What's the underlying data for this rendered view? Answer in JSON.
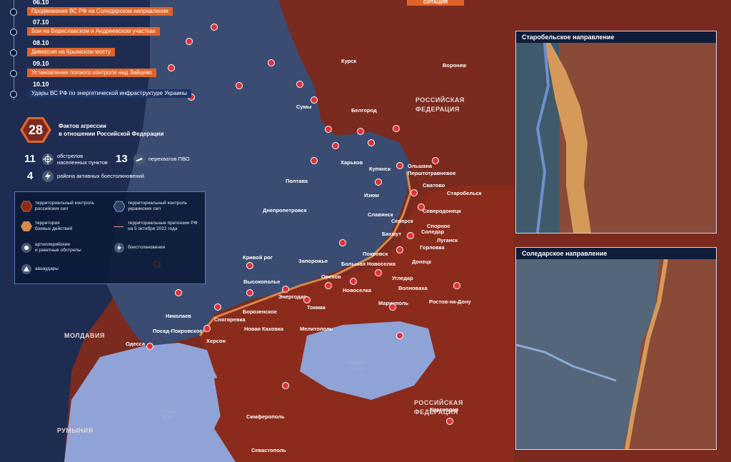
{
  "timeline": [
    {
      "date": "06.10",
      "text": "Продвижение ВС РФ на Соледарском направлении"
    },
    {
      "date": "07.10",
      "text": "Бои на Бериславском и Андреевском участках"
    },
    {
      "date": "08.10",
      "text": "Диверсия на Крымском мосту"
    },
    {
      "date": "09.10",
      "text": "Установление полного контроля над Зайцево"
    },
    {
      "date": "10.10",
      "text": "Удары ВС РФ по энергетической инфраструктуре Украины"
    }
  ],
  "stats": {
    "main_number": "28",
    "main_label_1": "Фактов агрессии",
    "main_label_2": "в отношении Российской Федерации",
    "shelling_number": "11",
    "shelling_label_1": "обстрелов",
    "shelling_label_2": "населенных пунктов",
    "intercept_number": "13",
    "intercept_label": "перехватов ПВО",
    "areas_number": "4",
    "areas_label": "района активных боестолкновений"
  },
  "legend": {
    "russian_control": "территориальный контроль российских сил",
    "ukrainian_control": "территориальный контроль украинских сил",
    "combat_zone_1": "территория",
    "combat_zone_2": "боевых действий",
    "claims_1": "территориальные претензии РФ",
    "claims_2": "на 5 октября 2022 года",
    "artillery_1": "артиллерийские",
    "artillery_2": "и ракетные обстрелы",
    "clashes": "боестолкновения",
    "airstrikes": "авиаудары"
  },
  "colors": {
    "russian_control": "#8b2b1c",
    "ukrainian_control": "#2c3f63",
    "combat_zone": "#d58a4a",
    "accent": "#e0642a",
    "sea": "#8fa3d6",
    "panel": "#0a1937"
  },
  "map": {
    "countries": [
      {
        "id": "russia",
        "label_1": "РОССИЙСКАЯ",
        "label_2": "ФЕДЕРАЦИЯ"
      },
      {
        "id": "russia-south",
        "label_1": "РОССИЙСКАЯ",
        "label_2": "ФЕДЕРАЦИЯ"
      },
      {
        "id": "moldova",
        "label_1": "МОЛДАВИЯ"
      },
      {
        "id": "romania",
        "label_1": "РУМЫНИЯ"
      }
    ],
    "seas": [
      {
        "id": "black-sea",
        "label_1": "Черное",
        "label_2": "море"
      },
      {
        "id": "azov-sea",
        "label_1": "Азовское",
        "label_2": "море"
      }
    ],
    "cities": [
      "Курск",
      "Воронеж",
      "Сумы",
      "Белгород",
      "Харьков",
      "Купянск",
      "Ольшана",
      "Перштотравневое",
      "Полтава",
      "Изюм",
      "Сватово",
      "Старобельск",
      "Славянск",
      "Северск",
      "Северодонецк",
      "Бахмут",
      "Спорное",
      "Соледар",
      "Днепропетровск",
      "Луганск",
      "Покровск",
      "Горловка",
      "Донецк",
      "Кривой рог",
      "Запорожье",
      "Большая Новоселка",
      "Орехов",
      "Угледар",
      "Высокополье",
      "Энергодар",
      "Новоселка",
      "Волноваха",
      "Ростов-на-Дону",
      "Токмак",
      "Мариуполь",
      "Николаев",
      "Борозенское",
      "Посад-Покровское",
      "Снигиревка",
      "Новая Каховка",
      "Херсон",
      "Мелитополь",
      "Одесса",
      "Симферополь",
      "Краснодар",
      "Севастополь"
    ]
  },
  "insets": [
    {
      "id": "starobelsk",
      "title": "Старобельское направление"
    },
    {
      "id": "soledar",
      "title": "Соледарское направление"
    }
  ],
  "logo": "СИТАЦИЯ"
}
